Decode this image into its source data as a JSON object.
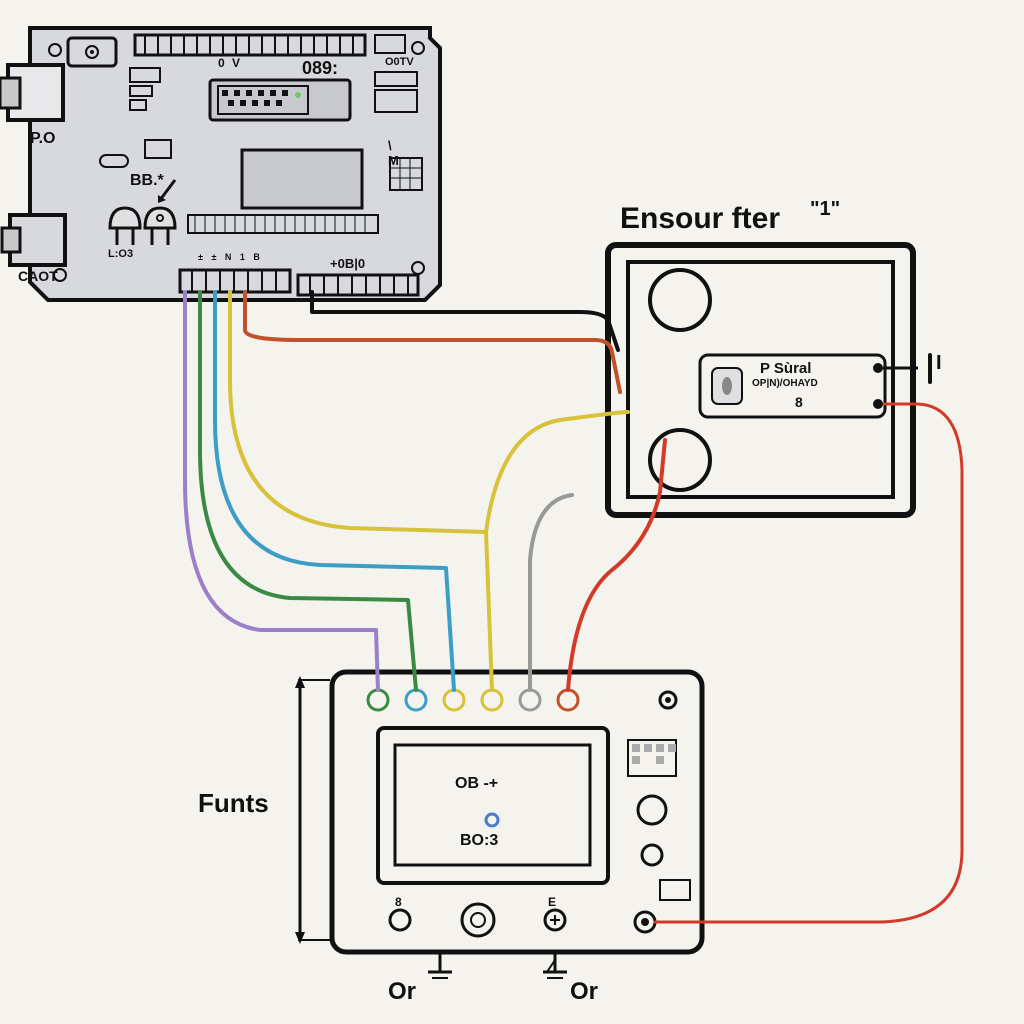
{
  "components": {
    "arduino": {
      "labels": {
        "port_left_top": "P.O",
        "port_left_bottom": "CAOT",
        "silkscreen_bb": "BB.*",
        "led_left": "L:O3",
        "chip_text": "089:",
        "pin_label_d": "0 V",
        "header_right": "O0TV",
        "header_bottom": "+0B|0"
      }
    },
    "module_right": {
      "title": "Ensour fter",
      "title_suffix": "\"1\"",
      "inner_label_1": "P Sùral",
      "inner_label_2": "OP|N)/OHAYD",
      "inner_label_3": "8",
      "terminal_right": "I"
    },
    "module_bottom": {
      "side_label": "Funts",
      "chip_line1": "OB -+",
      "chip_line2": "BO:3",
      "footer_left": "Or",
      "footer_right": "Or"
    }
  },
  "wires": [
    {
      "color": "#9b7fc9",
      "name": "purple"
    },
    {
      "color": "#3a8a44",
      "name": "green"
    },
    {
      "color": "#3c9dc6",
      "name": "cyan"
    },
    {
      "color": "#d8c23a",
      "name": "yellow"
    },
    {
      "color": "#c0512a",
      "name": "orange"
    },
    {
      "color": "#999",
      "name": "gray"
    },
    {
      "color": "#111",
      "name": "black"
    },
    {
      "color": "#d43a2a",
      "name": "red"
    }
  ]
}
